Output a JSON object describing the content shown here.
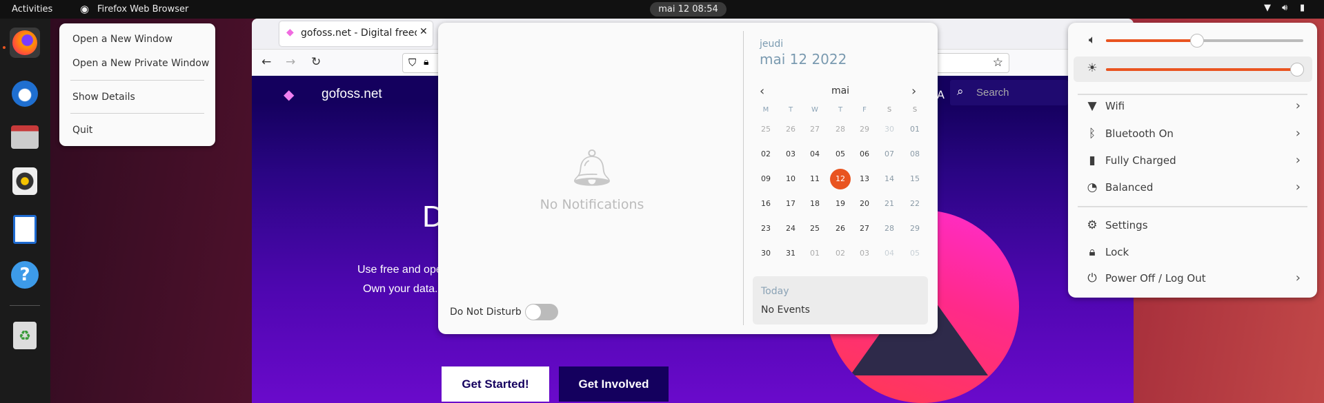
{
  "topbar": {
    "activities": "Activities",
    "app_name": "Firefox Web Browser",
    "clock": "mai 12  08:54",
    "tray_icons": [
      "wifi-icon",
      "volume-icon",
      "battery-icon"
    ]
  },
  "dock": {
    "apps": [
      {
        "name": "Firefox",
        "icon": "firefox-icon"
      },
      {
        "name": "Thunderbird",
        "icon": "thunderbird-icon"
      },
      {
        "name": "Files",
        "icon": "files-icon"
      },
      {
        "name": "Rhythmbox",
        "icon": "rhythmbox-icon"
      },
      {
        "name": "LibreOffice Writer",
        "icon": "writer-icon"
      },
      {
        "name": "Help",
        "icon": "help-icon"
      },
      {
        "name": "Trash",
        "icon": "trash-icon"
      }
    ]
  },
  "context_menu": {
    "items": [
      "Open a New Window",
      "Open a New Private Window",
      "Show Details",
      "Quit"
    ]
  },
  "browser": {
    "tab_title": "gofoss.net - Digital freed",
    "page": {
      "site_name": "gofoss.net",
      "search_placeholder": "Search",
      "hero_title": "D",
      "hero_line1": "Use free and ope",
      "hero_line2": "Own your data.",
      "btn_primary": "Get Started!",
      "btn_secondary": "Get Involved",
      "nav_partial": "A"
    }
  },
  "notifications": {
    "empty_text": "No Notifications",
    "dnd_label": "Do Not Disturb",
    "dnd_on": false
  },
  "calendar": {
    "weekday": "jeudi",
    "date": "mai 12 2022",
    "month": "mai",
    "weekdays": [
      "M",
      "T",
      "W",
      "T",
      "F",
      "S",
      "S"
    ],
    "today": "12",
    "weeks": [
      [
        [
          "25",
          1
        ],
        [
          "26",
          1
        ],
        [
          "27",
          1
        ],
        [
          "28",
          1
        ],
        [
          "29",
          1
        ],
        [
          "30",
          1
        ],
        [
          "01",
          0
        ]
      ],
      [
        [
          "02",
          0
        ],
        [
          "03",
          0
        ],
        [
          "04",
          0
        ],
        [
          "05",
          0
        ],
        [
          "06",
          0
        ],
        [
          "07",
          0
        ],
        [
          "08",
          0
        ]
      ],
      [
        [
          "09",
          0
        ],
        [
          "10",
          0
        ],
        [
          "11",
          0
        ],
        [
          "12",
          0
        ],
        [
          "13",
          0
        ],
        [
          "14",
          0
        ],
        [
          "15",
          0
        ]
      ],
      [
        [
          "16",
          0
        ],
        [
          "17",
          0
        ],
        [
          "18",
          0
        ],
        [
          "19",
          0
        ],
        [
          "20",
          0
        ],
        [
          "21",
          0
        ],
        [
          "22",
          0
        ]
      ],
      [
        [
          "23",
          0
        ],
        [
          "24",
          0
        ],
        [
          "25",
          0
        ],
        [
          "26",
          0
        ],
        [
          "27",
          0
        ],
        [
          "28",
          0
        ],
        [
          "29",
          0
        ]
      ],
      [
        [
          "30",
          0
        ],
        [
          "31",
          0
        ],
        [
          "01",
          1
        ],
        [
          "02",
          1
        ],
        [
          "03",
          1
        ],
        [
          "04",
          1
        ],
        [
          "05",
          1
        ]
      ]
    ],
    "events_header": "Today",
    "events_text": "No Events"
  },
  "system_menu": {
    "volume": 0.46,
    "brightness": 0.97,
    "items": [
      {
        "label": "Wifi",
        "icon": "wifi-icon"
      },
      {
        "label": "Bluetooth On",
        "icon": "bluetooth-icon"
      },
      {
        "label": "Fully Charged",
        "icon": "battery-icon"
      },
      {
        "label": "Balanced",
        "icon": "power-profile-icon"
      },
      {
        "label": "Settings",
        "icon": "gear-icon"
      },
      {
        "label": "Lock",
        "icon": "lock-icon"
      },
      {
        "label": "Power Off / Log Out",
        "icon": "power-icon"
      }
    ]
  },
  "colors": {
    "accent": "#e95420",
    "page_header": "#14005e",
    "page_gradient_end": "#6a0acb"
  }
}
